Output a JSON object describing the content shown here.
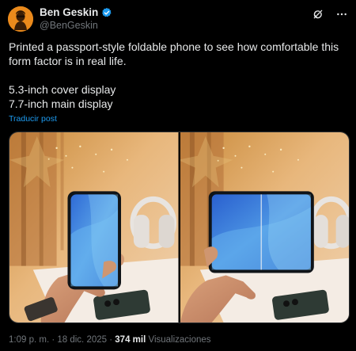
{
  "author": {
    "name": "Ben Geskin",
    "handle": "@BenGeskin",
    "verified": true,
    "avatar_icon": "avatar-silhouette-icon"
  },
  "actions": {
    "grok_icon": "grok-icon",
    "more_icon": "more-icon"
  },
  "tweet": {
    "line1": "Printed a passport-style foldable phone to see how comfortable this form factor is in real life.",
    "line2": "5.3-inch cover display",
    "line3": "7.7-inch main display",
    "translate_label": "Traducir post"
  },
  "media": {
    "photo1_icon": "folded-phone-photo",
    "photo2_icon": "unfolded-phone-photo"
  },
  "footer": {
    "time": "1:09 p. m.",
    "separator1": " · ",
    "date": "18 dic. 2025",
    "separator2": " · ",
    "views_count": "374 mil",
    "views_label": "Visualizaciones"
  },
  "colors": {
    "background": "#000000",
    "text": "#e7e9ea",
    "muted": "#71767b",
    "link": "#1d9bf0",
    "verified": "#1d9bf0",
    "avatar": "#e07b12"
  }
}
